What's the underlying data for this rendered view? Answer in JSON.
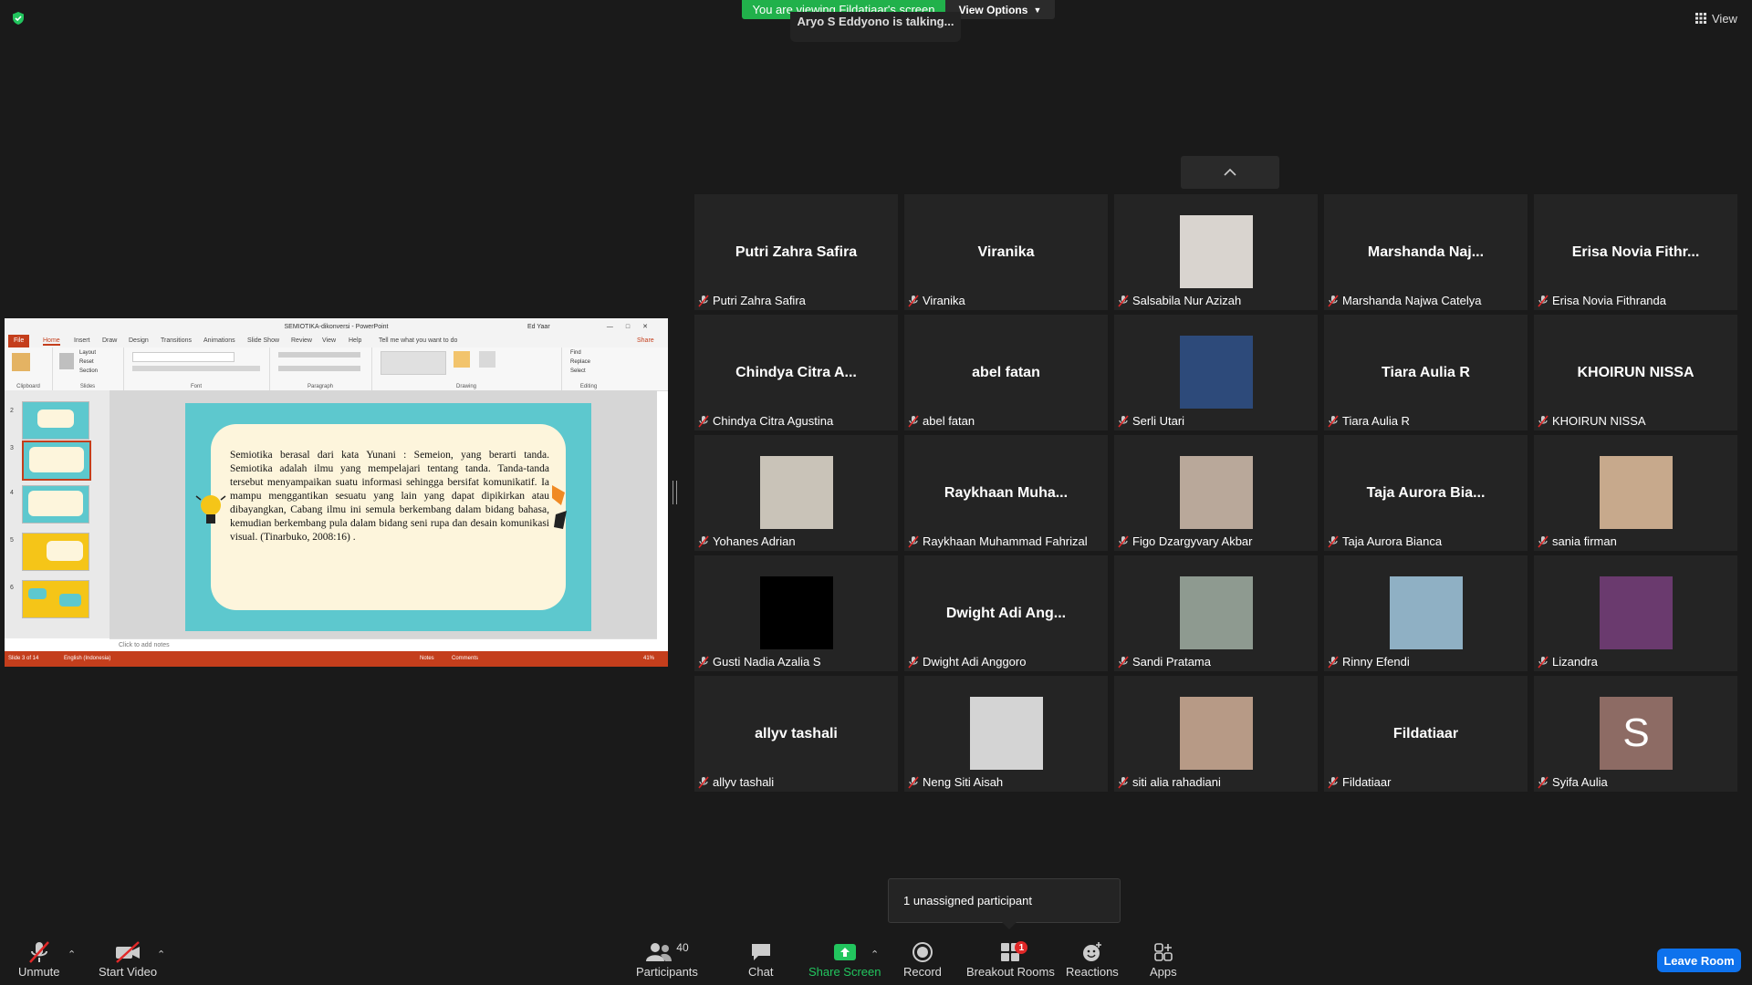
{
  "top": {
    "sharing_banner": "You are viewing Fildatiaar's screen",
    "view_options": "View Options",
    "talking": "Aryo S Eddyono is talking...",
    "view": "View"
  },
  "ppt": {
    "window_title": "SEMIOTIKA-dikonversi  -  PowerPoint",
    "user": "Ed Yaar",
    "tabs": [
      "File",
      "Home",
      "Insert",
      "Draw",
      "Design",
      "Transitions",
      "Animations",
      "Slide Show",
      "Review",
      "View",
      "Help"
    ],
    "tell_me": "Tell me what you want to do",
    "share": "Share",
    "groups": [
      "Clipboard",
      "Slides",
      "Font",
      "Paragraph",
      "Drawing",
      "Editing"
    ],
    "editing": [
      "Find",
      "Replace",
      "Select"
    ],
    "slide_buttons": [
      "Layout",
      "Reset",
      "Section"
    ],
    "slide_text": "Semiotika berasal dari kata Yunani : Semeion, yang berarti tanda. Semiotika adalah ilmu yang mempelajari tentang tanda. Tanda-tanda tersebut menyampaikan suatu informasi sehingga bersifat komunikatif. Ia mampu menggantikan sesuatu yang lain yang dapat dipikirkan atau dibayangkan, Cabang ilmu ini semula berkembang dalam bidang bahasa, kemudian berkembang pula dalam bidang  seni rupa dan desain komunikasi visual. (Tinarbuko, 2008:16) .",
    "thumb_numbers": [
      "2",
      "3",
      "4",
      "5",
      "6"
    ],
    "notes_placeholder": "Click to add notes",
    "status_slide": "Slide 3 of 14",
    "status_lang": "English (Indonesia)",
    "status_notes": "Notes",
    "status_comments": "Comments",
    "zoom": "41%"
  },
  "participants": [
    {
      "big": "Putri Zahra Safira",
      "name": "Putri Zahra Safira",
      "photo": ""
    },
    {
      "big": "Viranika",
      "name": "Viranika",
      "photo": ""
    },
    {
      "big": "",
      "name": "Salsabila Nur Azizah",
      "photo": "#d9d4cf"
    },
    {
      "big": "Marshanda  Naj...",
      "name": "Marshanda Najwa Catelya",
      "photo": ""
    },
    {
      "big": "Erisa Novia Fithr...",
      "name": "Erisa Novia Fithranda",
      "photo": ""
    },
    {
      "big": "Chindya Citra A...",
      "name": "Chindya Citra Agustina",
      "photo": ""
    },
    {
      "big": "abel fatan",
      "name": "abel fatan",
      "photo": ""
    },
    {
      "big": "",
      "name": "Serli Utari",
      "photo": "#2d4a7a"
    },
    {
      "big": "Tiara Aulia R",
      "name": "Tiara Aulia R",
      "photo": ""
    },
    {
      "big": "KHOIRUN NISSA",
      "name": "KHOIRUN NISSA",
      "photo": ""
    },
    {
      "big": "",
      "name": "Yohanes Adrian",
      "photo": "#c9c3b8"
    },
    {
      "big": "Raykhaan  Muha...",
      "name": "Raykhaan Muhammad Fahrizal",
      "photo": ""
    },
    {
      "big": "",
      "name": "Figo Dzargyvary Akbar",
      "photo": "#b9a89a"
    },
    {
      "big": "Taja Aurora Bia...",
      "name": "Taja Aurora Bianca",
      "photo": ""
    },
    {
      "big": "",
      "name": "sania firman",
      "photo": "#c7a98c"
    },
    {
      "big": "",
      "name": "Gusti Nadia Azalia S",
      "photo": "#000000"
    },
    {
      "big": "Dwight Adi Ang...",
      "name": "Dwight Adi Anggoro",
      "photo": ""
    },
    {
      "big": "",
      "name": "Sandi Pratama",
      "photo": "#8e9a90"
    },
    {
      "big": "",
      "name": "Rinny Efendi",
      "photo": "#8fb0c4"
    },
    {
      "big": "",
      "name": "Lizandra",
      "photo": "#6a3a6e"
    },
    {
      "big": "allyv tashali",
      "name": "allyv tashali",
      "photo": ""
    },
    {
      "big": "",
      "name": "Neng Siti Aisah",
      "photo": "#d4d4d4"
    },
    {
      "big": "",
      "name": "siti alia rahadiani",
      "photo": "#b79a86"
    },
    {
      "big": "Fildatiaar",
      "name": "Fildatiaar",
      "photo": ""
    },
    {
      "big": "",
      "name": "Syifa Aulia",
      "photo": "",
      "initial": "S"
    }
  ],
  "tooltip": "1 unassigned participant",
  "toolbar": {
    "unmute": "Unmute",
    "start_video": "Start Video",
    "participants": "Participants",
    "participant_count": "40",
    "chat": "Chat",
    "share_screen": "Share Screen",
    "record": "Record",
    "breakout_rooms": "Breakout Rooms",
    "breakout_badge": "1",
    "reactions": "Reactions",
    "apps": "Apps",
    "leave_room": "Leave Room"
  },
  "colors": {
    "accent_green": "#21b14b",
    "leave_blue": "#0e72ed",
    "mute_red": "#e02828",
    "ppt_orange": "#c43e1c",
    "slide_teal": "#5dc8ce",
    "avatar_s": "#8d6b64"
  }
}
